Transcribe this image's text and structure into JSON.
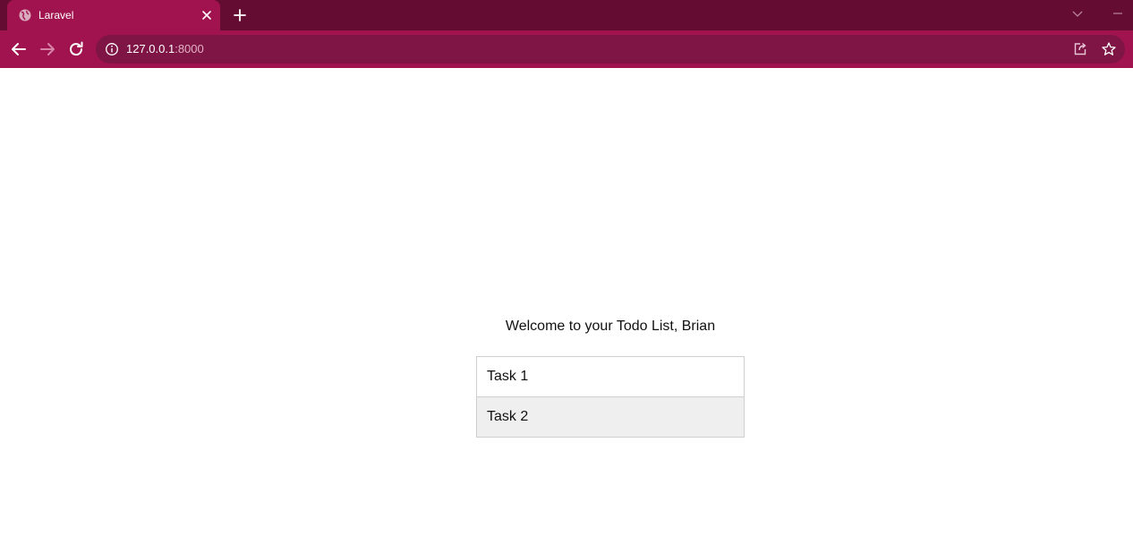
{
  "browser": {
    "tab": {
      "title": "Laravel"
    },
    "address": {
      "host": "127.0.0.1",
      "port": ":8000"
    }
  },
  "page": {
    "welcome": "Welcome to your Todo List, Brian",
    "tasks": [
      {
        "label": "Task 1"
      },
      {
        "label": "Task 2"
      }
    ]
  },
  "colors": {
    "tabstrip": "#650c33",
    "active_tab": "#a1134f",
    "toolbar": "#a1134f",
    "omnibox": "#7e1544"
  },
  "icons": {
    "favicon": "globe-icon",
    "tab_close": "close-icon",
    "new_tab": "plus-icon",
    "tab_search": "chevron-down-icon",
    "minimize": "minimize-icon",
    "back": "arrow-left-icon",
    "forward": "arrow-right-icon",
    "reload": "reload-icon",
    "site_info": "info-icon",
    "share": "share-icon",
    "bookmark": "star-icon"
  }
}
